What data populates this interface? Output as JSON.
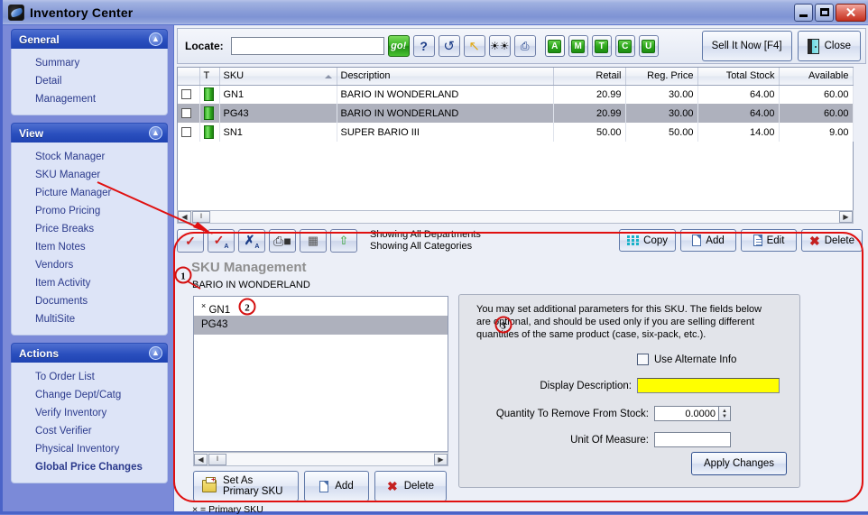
{
  "window": {
    "title": "Inventory Center",
    "icon": "app-swoosh-icon",
    "minimize_label": "–",
    "maximize_label": "□",
    "close_label": "✕"
  },
  "sidebar": {
    "groups": [
      {
        "title": "General",
        "collapse_icon": "chevron-up-icon",
        "items": [
          {
            "label": "Summary",
            "bold": false
          },
          {
            "label": "Detail",
            "bold": false
          },
          {
            "label": "Management",
            "bold": false
          }
        ]
      },
      {
        "title": "View",
        "collapse_icon": "chevron-up-icon",
        "items": [
          {
            "label": "Stock Manager",
            "bold": false
          },
          {
            "label": "SKU Manager",
            "bold": false
          },
          {
            "label": "Picture Manager",
            "bold": false
          },
          {
            "label": "Promo Pricing",
            "bold": false
          },
          {
            "label": "Price Breaks",
            "bold": false
          },
          {
            "label": "Item Notes",
            "bold": false
          },
          {
            "label": "Vendors",
            "bold": false
          },
          {
            "label": "Item Activity",
            "bold": false
          },
          {
            "label": "Documents",
            "bold": false
          },
          {
            "label": "MultiSite",
            "bold": false
          }
        ]
      },
      {
        "title": "Actions",
        "collapse_icon": "chevron-up-icon",
        "items": [
          {
            "label": "To Order List",
            "bold": false
          },
          {
            "label": "Change Dept/Catg",
            "bold": false
          },
          {
            "label": "Verify Inventory",
            "bold": false
          },
          {
            "label": "Cost Verifier",
            "bold": false
          },
          {
            "label": "Physical Inventory",
            "bold": false
          },
          {
            "label": "Global Price Changes",
            "bold": true
          }
        ]
      }
    ]
  },
  "toolbar": {
    "locate_label": "Locate:",
    "locate_value": "",
    "locate_placeholder": "",
    "go_label": "go!",
    "icon_buttons": [
      {
        "name": "help-icon",
        "glyph": "?"
      },
      {
        "name": "refresh-icon",
        "glyph": "↺"
      },
      {
        "name": "jump-up-icon",
        "glyph": "↖"
      },
      {
        "name": "binoculars-icon",
        "glyph": "⚈"
      },
      {
        "name": "preview-icon",
        "glyph": "⌕"
      }
    ],
    "letter_buttons": [
      {
        "label": "A",
        "pressed": true
      },
      {
        "label": "M",
        "pressed": false
      },
      {
        "label": "T",
        "pressed": false
      },
      {
        "label": "C",
        "pressed": false
      },
      {
        "label": "U",
        "pressed": false
      }
    ],
    "sell_now_label": "Sell It Now [F4]",
    "close_label": "Close",
    "close_icon": "door-exit-icon"
  },
  "grid": {
    "columns": [
      "",
      "T",
      "SKU",
      "Description",
      "Retail",
      "Reg. Price",
      "Total Stock",
      "Available"
    ],
    "sorted_column": "SKU",
    "sort_direction": "ascending",
    "rows": [
      {
        "checked": false,
        "type": "green-bar-icon",
        "sku": "GN1",
        "description": "BARIO IN WONDERLAND",
        "retail": "20.99",
        "retail_highlight": true,
        "reg_price": "30.00",
        "total_stock": "64.00",
        "available": "60.00",
        "selected": false
      },
      {
        "checked": false,
        "type": "green-bar-icon",
        "sku": "PG43",
        "description": "BARIO IN WONDERLAND",
        "retail": "20.99",
        "retail_highlight": false,
        "reg_price": "30.00",
        "total_stock": "64.00",
        "available": "60.00",
        "selected": true
      },
      {
        "checked": false,
        "type": "green-bar-icon",
        "sku": "SN1",
        "description": "SUPER BARIO III",
        "retail": "50.00",
        "retail_highlight": false,
        "reg_price": "50.00",
        "total_stock": "14.00",
        "available": "9.00",
        "selected": false
      }
    ]
  },
  "action_row": {
    "tool_buttons": [
      {
        "name": "check-icon",
        "glyph": "✓"
      },
      {
        "name": "check-all-icon",
        "glyph": "✓"
      },
      {
        "name": "uncheck-all-icon",
        "glyph": "✗"
      },
      {
        "name": "print-icon",
        "glyph": "⎙"
      },
      {
        "name": "list-icon",
        "glyph": "☰"
      },
      {
        "name": "export-up-icon",
        "glyph": "⇧"
      }
    ],
    "status_line1": "Showing All Departments",
    "status_line2": "Showing All Categories",
    "buttons": [
      {
        "label": "Copy",
        "icon": "copy-grid-icon"
      },
      {
        "label": "Add",
        "icon": "new-doc-icon"
      },
      {
        "label": "Edit",
        "icon": "edit-doc-icon"
      },
      {
        "label": "Delete",
        "icon": "red-x-icon"
      }
    ]
  },
  "sku_management": {
    "title": "SKU Management",
    "subtitle": "BARIO IN WONDERLAND",
    "list": [
      {
        "sku": "GN1",
        "primary": true,
        "primary_marker": "×",
        "selected": false
      },
      {
        "sku": "PG43",
        "primary": false,
        "primary_marker": "",
        "selected": true
      }
    ],
    "buttons": [
      {
        "label": "Set As Primary SKU",
        "icon": "set-primary-icon"
      },
      {
        "label": "Add",
        "icon": "new-doc-icon"
      },
      {
        "label": "Delete",
        "icon": "red-x-icon"
      }
    ],
    "footnote": "× = Primary SKU"
  },
  "parameters": {
    "description": "You may set additional parameters for this SKU.  The fields below are optional, and should be used only if you are selling different quantities of the same product (case, six-pack, etc.).",
    "use_alternate_label": "Use Alternate Info",
    "use_alternate_checked": false,
    "fields": [
      {
        "label": "Display Description:",
        "value": "",
        "highlight_color": "#ffff00"
      },
      {
        "label": "Quantity To Remove From Stock:",
        "value": "0.0000",
        "highlight_color": "#ffffff"
      },
      {
        "label": "Unit Of Measure:",
        "value": "",
        "highlight_color": "#ffffff"
      }
    ],
    "apply_label": "Apply Changes"
  },
  "annotations": {
    "markers": [
      {
        "number": "1",
        "target": "primary-sku-marker"
      },
      {
        "number": "2",
        "target": "selected-sku-pg43"
      },
      {
        "number": "3",
        "target": "parameters-panel"
      }
    ],
    "arrow_from": "SKU Manager",
    "highlight_color": "#d41010"
  },
  "scrollbars": {
    "left_arrow": "◀",
    "right_arrow": "▶",
    "thumb_grip": "‖"
  }
}
